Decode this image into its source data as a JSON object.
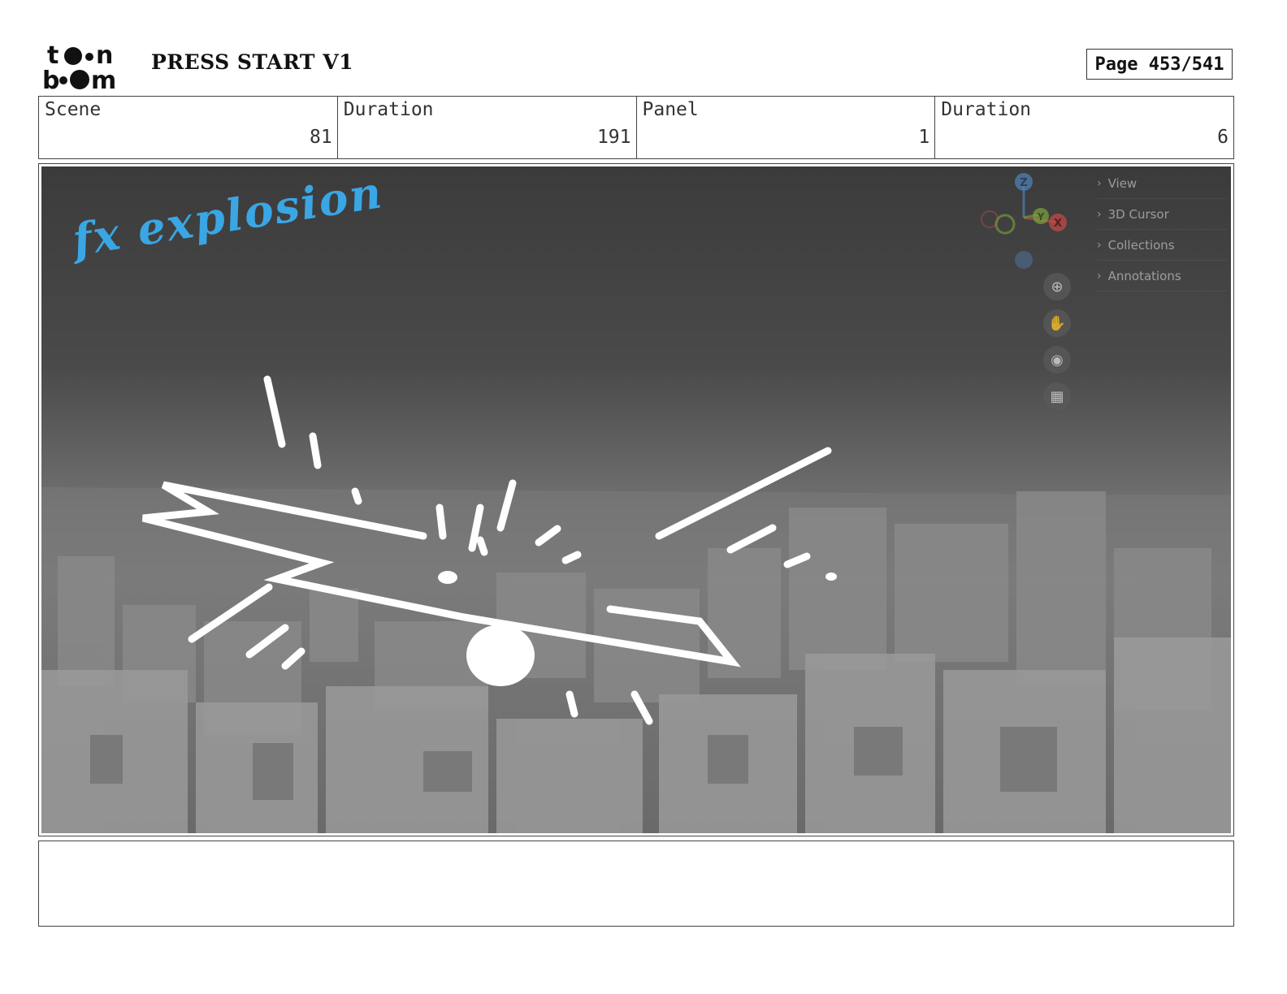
{
  "header": {
    "logo_text_top": "toon",
    "logo_text_bottom": "boom",
    "project_title": "PRESS START V1",
    "page_label": "Page 453/541"
  },
  "info": [
    {
      "label": "Scene",
      "value": "81"
    },
    {
      "label": "Duration",
      "value": "191"
    },
    {
      "label": "Panel",
      "value": "1"
    },
    {
      "label": "Duration",
      "value": "6"
    }
  ],
  "panel": {
    "handwritten_note": "fx explosion",
    "viewport_menu": [
      "View",
      "3D Cursor",
      "Collections",
      "Annotations"
    ],
    "gizmo_axes": [
      "Z",
      "Y",
      "X"
    ],
    "view_tools": [
      "zoom-icon",
      "hand-pan-icon",
      "camera-icon",
      "grid-icon"
    ]
  },
  "colors": {
    "note_color": "#3aa6e4",
    "sketch_color": "#ffffff"
  },
  "dialogue": ""
}
